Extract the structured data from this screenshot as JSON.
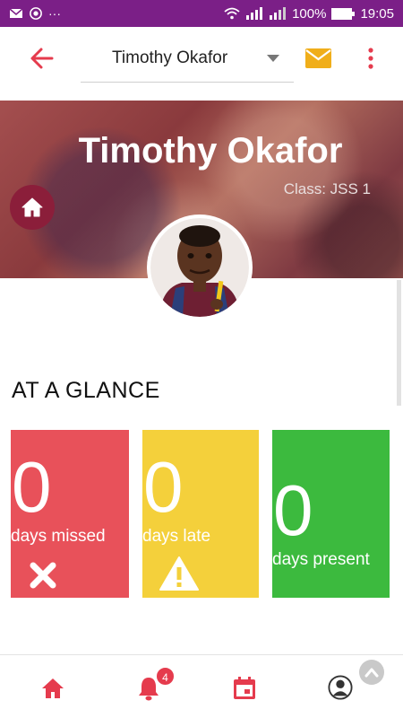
{
  "status_bar": {
    "time": "19:05",
    "battery": "100%",
    "left_icons": [
      "envelope-icon",
      "whatsapp-icon",
      "more-icon"
    ],
    "right_icons": [
      "wifi-icon",
      "signal-icon",
      "signal-icon"
    ]
  },
  "app_bar": {
    "student_name": "Timothy Okafor",
    "back_icon": "back-arrow-icon",
    "mail_icon": "mail-icon",
    "menu_icon": "more-vert-icon"
  },
  "hero": {
    "name": "Timothy Okafor",
    "class_label": "Class: JSS 1"
  },
  "glance": {
    "title": "AT A GLANCE",
    "cards": [
      {
        "value": "0",
        "label": "days missed",
        "color": "#e8515a",
        "icon": "close-icon"
      },
      {
        "value": "0",
        "label": "days late",
        "color": "#f4d03b",
        "icon": "warning-icon"
      },
      {
        "value": "0",
        "label": "days present",
        "color": "#3cba3e",
        "icon": ""
      }
    ]
  },
  "bottom_nav": {
    "notification_count": "4",
    "items": [
      "home-icon",
      "bell-icon",
      "calendar-icon",
      "profile-icon"
    ]
  },
  "colors": {
    "accent": "#e53b4d",
    "status_bar": "#7b1f87",
    "mail": "#f0ae1a"
  }
}
